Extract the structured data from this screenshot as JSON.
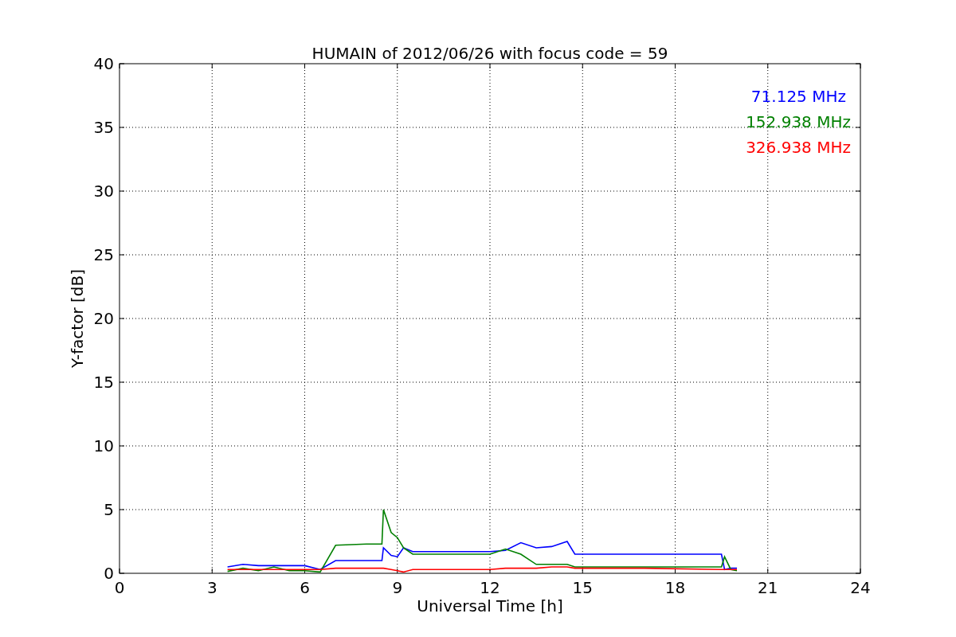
{
  "chart_data": {
    "type": "line",
    "title": "HUMAIN of 2012/06/26 with focus code = 59",
    "xlabel": "Universal Time [h]",
    "ylabel": "Y-factor [dB]",
    "x": [
      3.5,
      4,
      4.5,
      5,
      5.5,
      6,
      6.5,
      7,
      7.5,
      8,
      8.5,
      8.55,
      8.8,
      9,
      9.2,
      9.5,
      10,
      11,
      12,
      12.5,
      13,
      13.5,
      14,
      14.5,
      14.75,
      15,
      17,
      19.5,
      19.6,
      19.8,
      20
    ],
    "series": [
      {
        "name": "71.125 MHz",
        "color": "#0000ff",
        "values": [
          0.5,
          0.7,
          0.6,
          0.6,
          0.6,
          0.6,
          0.3,
          1.0,
          1.0,
          1.0,
          1.0,
          2.0,
          1.4,
          1.3,
          2.0,
          1.7,
          1.7,
          1.7,
          1.7,
          1.8,
          2.4,
          2.0,
          2.1,
          2.5,
          1.5,
          1.5,
          1.5,
          1.5,
          0.3,
          0.4,
          0.4
        ]
      },
      {
        "name": "152.938 MHz",
        "color": "#008000",
        "values": [
          0.15,
          0.4,
          0.2,
          0.5,
          0.2,
          0.2,
          0.1,
          2.2,
          2.25,
          2.3,
          2.3,
          5.0,
          3.2,
          2.8,
          2.0,
          1.5,
          1.5,
          1.5,
          1.5,
          1.9,
          1.5,
          0.7,
          0.7,
          0.7,
          0.5,
          0.5,
          0.5,
          0.5,
          1.3,
          0.3,
          0.2
        ]
      },
      {
        "name": "326.938 MHz",
        "color": "#ff0000",
        "values": [
          0.3,
          0.3,
          0.3,
          0.3,
          0.3,
          0.3,
          0.3,
          0.4,
          0.4,
          0.4,
          0.4,
          0.4,
          0.3,
          0.2,
          0.1,
          0.3,
          0.3,
          0.3,
          0.3,
          0.4,
          0.4,
          0.4,
          0.5,
          0.5,
          0.4,
          0.4,
          0.4,
          0.3,
          0.3,
          0.3,
          0.3
        ]
      }
    ],
    "grid": true,
    "xlim": [
      0,
      24
    ],
    "ylim": [
      0,
      40
    ],
    "xticks": [
      0,
      3,
      6,
      9,
      12,
      15,
      18,
      21,
      24
    ],
    "yticks": [
      0,
      5,
      10,
      15,
      20,
      25,
      30,
      35,
      40
    ]
  }
}
